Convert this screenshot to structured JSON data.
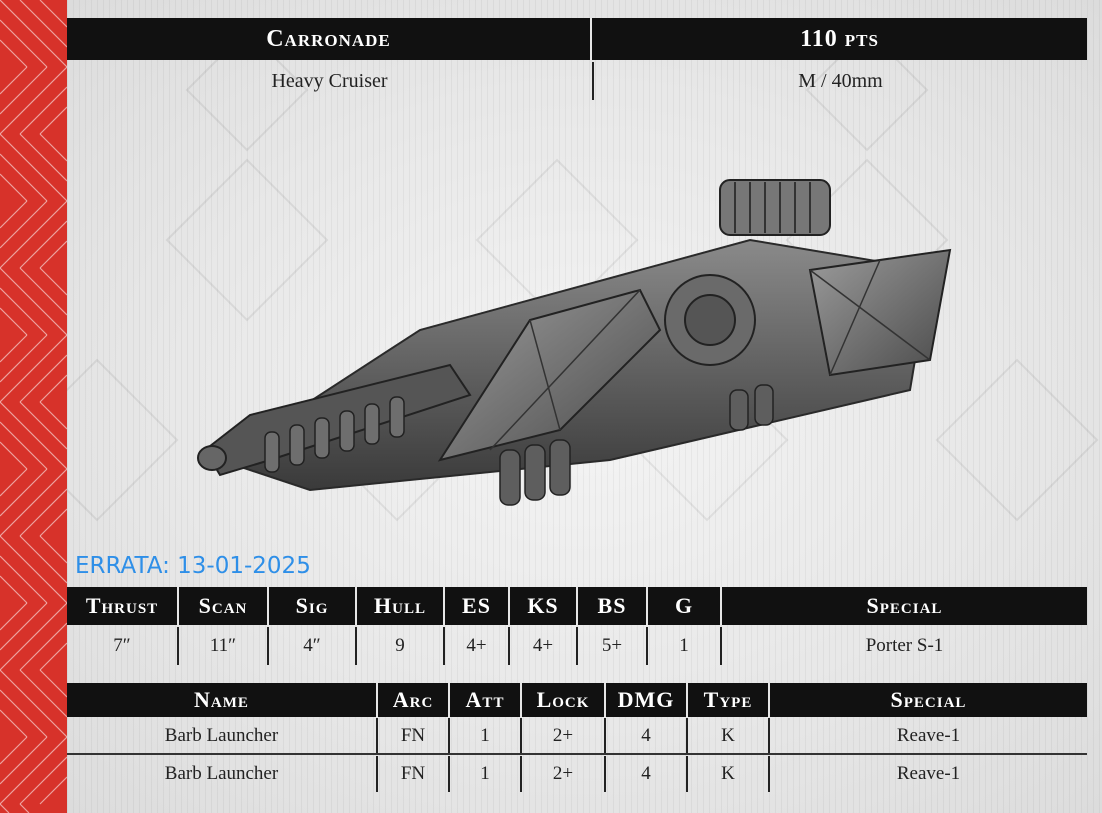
{
  "unit": {
    "name": "Carronade",
    "points": "110 pts",
    "class": "Heavy Cruiser",
    "base": "M / 40mm"
  },
  "errata": "ERRATA: 13-01-2025",
  "stats": {
    "headers": [
      "Thrust",
      "Scan",
      "Sig",
      "Hull",
      "ES",
      "KS",
      "BS",
      "G",
      "Special"
    ],
    "values": [
      "7″",
      "11″",
      "4″",
      "9",
      "4+",
      "4+",
      "5+",
      "1",
      "Porter S-1"
    ]
  },
  "weapons": {
    "headers": [
      "Name",
      "Arc",
      "Att",
      "Lock",
      "DMG",
      "Type",
      "Special"
    ],
    "rows": [
      [
        "Barb Launcher",
        "FN",
        "1",
        "2+",
        "4",
        "K",
        "Reave-1"
      ],
      [
        "Barb Launcher",
        "FN",
        "1",
        "2+",
        "4",
        "K",
        "Reave-1"
      ]
    ]
  },
  "colors": {
    "side_band": "#d7322a",
    "header_bg": "#111111",
    "errata_text": "#2e8fe8"
  },
  "image": {
    "subject": "starship miniature render",
    "icon": "ship-model-image"
  }
}
